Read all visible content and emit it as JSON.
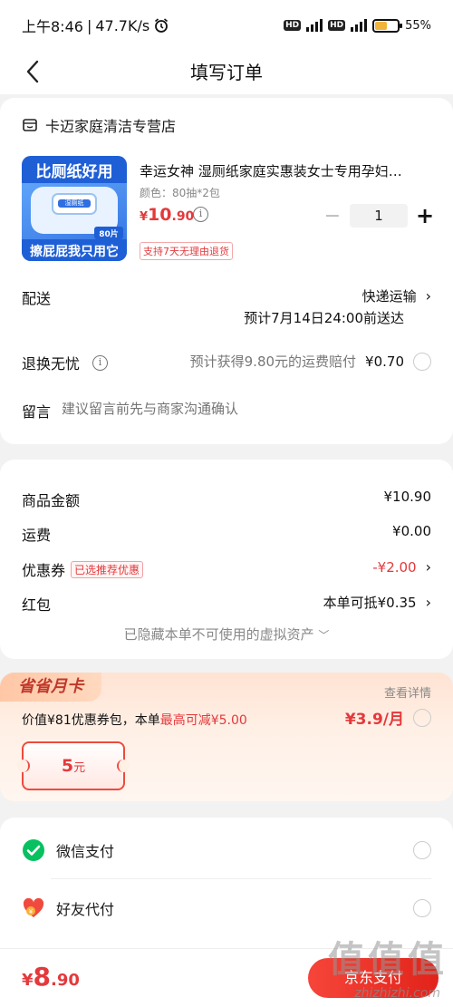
{
  "status_bar": {
    "time": "上午8:46",
    "speed": "47.7K/s",
    "battery": "55%",
    "battery_level": 0.55
  },
  "nav": {
    "title": "填写订单"
  },
  "shop": {
    "name": "卡迈家庭清洁专营店"
  },
  "product": {
    "title": "幸运女神 湿厕纸家庭实惠装女士专用孕妇…",
    "spec": "颜色：80抽*2包",
    "price_symbol": "¥",
    "price_int": "10",
    "price_dec": ".90",
    "quantity": "1",
    "return_tag": "支持7天无理由退货",
    "image_text": {
      "banner_top": "比厕纸好用",
      "banner_bottom": "擦屁屁我只用它",
      "count": "80片",
      "pack": "湿厕纸"
    }
  },
  "delivery": {
    "label": "配送",
    "method": "快递运输",
    "eta": "预计7月14日24:00前送达"
  },
  "return_insurance": {
    "label": "退换无忧",
    "desc": "预计获得9.80元的运费赔付",
    "price": "¥0.70"
  },
  "message": {
    "label": "留言",
    "placeholder": "建议留言前先与商家沟通确认"
  },
  "summary": {
    "goods_label": "商品金额",
    "goods_value": "¥10.90",
    "shipping_label": "运费",
    "shipping_value": "¥0.00",
    "coupon_label": "优惠券",
    "coupon_tag": "已选推荐优惠",
    "coupon_value": "-¥2.00",
    "redpacket_label": "红包",
    "redpacket_value": "本单可抵¥0.35",
    "hidden_assets": "已隐藏本单不可使用的虚拟资产"
  },
  "month_card": {
    "badge": "省省月卡",
    "detail": "查看详情",
    "desc_prefix": "价值¥81优惠券包，本单",
    "desc_highlight": "最高可减¥5.00",
    "price": "¥3.9/月",
    "coupon_amount": "5",
    "coupon_unit": "元"
  },
  "payment": {
    "wechat": "微信支付",
    "friend": "好友代付"
  },
  "bottom": {
    "symbol": "¥",
    "total_int": "8",
    "total_dec": ".90",
    "pay_button": "京东支付"
  },
  "watermark": {
    "text": "值",
    "site": "zhizhizhi.com"
  },
  "colors": {
    "accent": "#e4393c",
    "wechat": "#07c160"
  }
}
